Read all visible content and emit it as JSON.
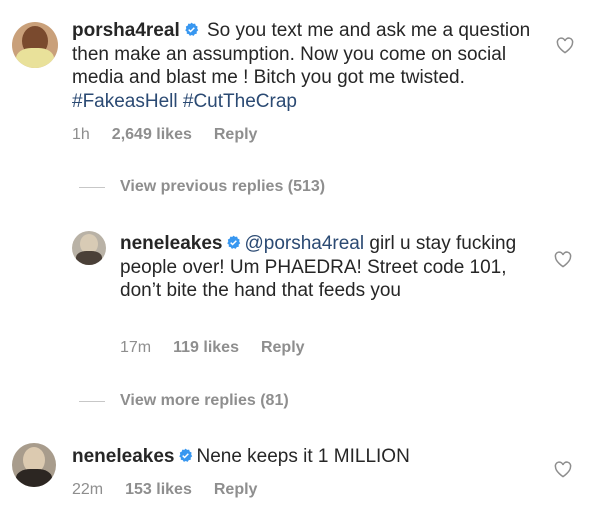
{
  "comments": [
    {
      "username": "porsha4real",
      "text_plain": " So you text me and ask me a question then make an assumption. Now you come on social media and blast me ! Bitch you got me twisted. ",
      "hashtags": [
        "#FakeasHell",
        "#CutTheCrap"
      ],
      "time": "1h",
      "likes": "2,649 likes",
      "reply": "Reply"
    },
    {
      "username": "neneleakes",
      "mention": "@porsha4real",
      "text_plain": " girl u stay fucking people over! Um PHAEDRA! Street code 101, don’t bite the hand that feeds you",
      "time": "17m",
      "likes": "119 likes",
      "reply": "Reply"
    },
    {
      "username": "neneleakes",
      "text_plain": "Nene keeps it 1 MILLION",
      "time": "22m",
      "likes": "153 likes",
      "reply": "Reply"
    }
  ],
  "view_previous": "View previous replies (513)",
  "view_more": "View more replies (81)",
  "icons": {
    "verified": "verified-badge-icon",
    "like": "heart-icon"
  },
  "colors": {
    "verified": "#3897f0",
    "link": "#2b4a73",
    "meta": "#8e8e8e"
  }
}
